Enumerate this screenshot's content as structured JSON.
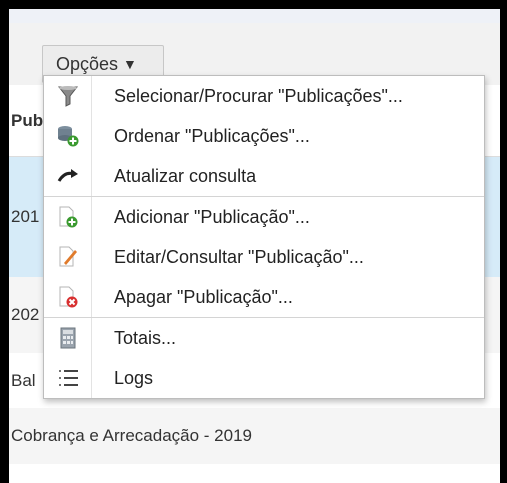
{
  "toolbar": {
    "options_label": "Opções",
    "caret": "▼"
  },
  "table": {
    "header_text": "Pub",
    "rows": [
      "201",
      "202",
      "Bal",
      "Cobrança e Arrecadação - 2019",
      ""
    ]
  },
  "menu": {
    "items": [
      {
        "label": "Selecionar/Procurar \"Publicações\"...",
        "icon": "filter-icon"
      },
      {
        "label": "Ordenar \"Publicações\"...",
        "icon": "sort-database-icon"
      },
      {
        "label": "Atualizar consulta",
        "icon": "refresh-arrow-icon"
      },
      {
        "label": "Adicionar \"Publicação\"...",
        "icon": "add-document-icon"
      },
      {
        "label": "Editar/Consultar \"Publicação\"...",
        "icon": "edit-document-icon"
      },
      {
        "label": "Apagar \"Publicação\"...",
        "icon": "delete-document-icon"
      },
      {
        "label": "Totais...",
        "icon": "calculator-icon"
      },
      {
        "label": "Logs",
        "icon": "list-icon"
      }
    ]
  }
}
